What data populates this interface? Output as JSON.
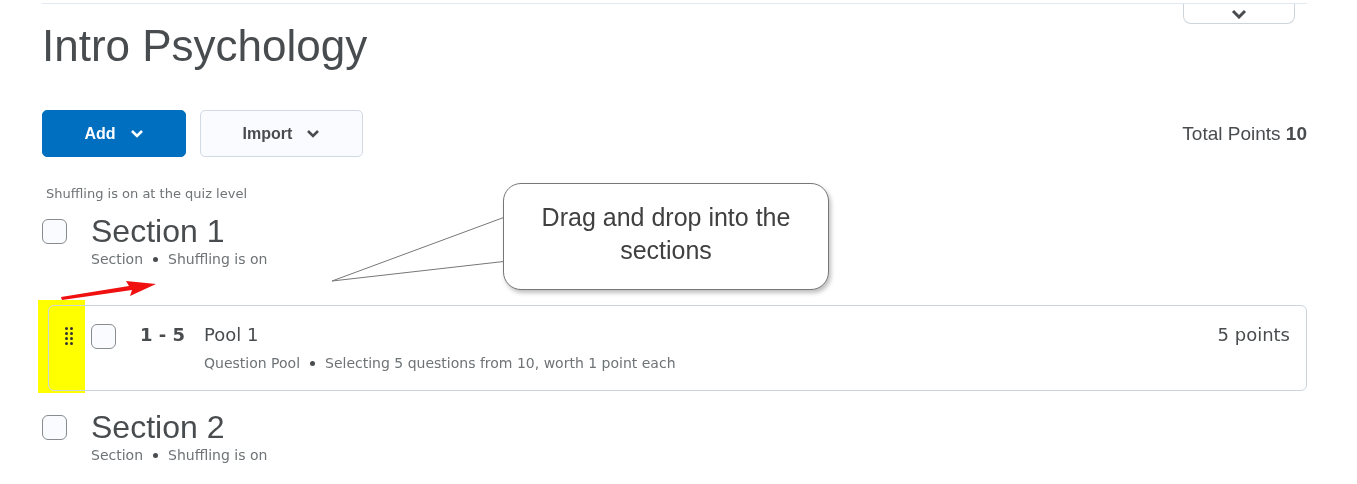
{
  "title": "Intro Psychology",
  "toolbar": {
    "buttons": [
      {
        "label": "Add",
        "kind": "primary"
      },
      {
        "label": "Import",
        "kind": "secondary"
      }
    ],
    "total_label": "Total Points",
    "total_value": "10"
  },
  "shuffle_note": "Shuffling is on at the quiz level",
  "items": [
    {
      "kind": "section",
      "title": "Section 1",
      "checked": false,
      "meta": [
        "Section",
        "Shuffling is on"
      ]
    },
    {
      "kind": "pool",
      "range": "1 - 5",
      "title": "Pool 1",
      "checked": false,
      "points": "5 points",
      "meta": [
        "Question Pool",
        "Selecting 5 questions from 10, worth 1 point each"
      ]
    },
    {
      "kind": "section",
      "title": "Section 2",
      "checked": false,
      "meta": [
        "Section",
        "Shuffling is on"
      ]
    }
  ],
  "callout": {
    "text": "Drag and drop into the sections"
  }
}
